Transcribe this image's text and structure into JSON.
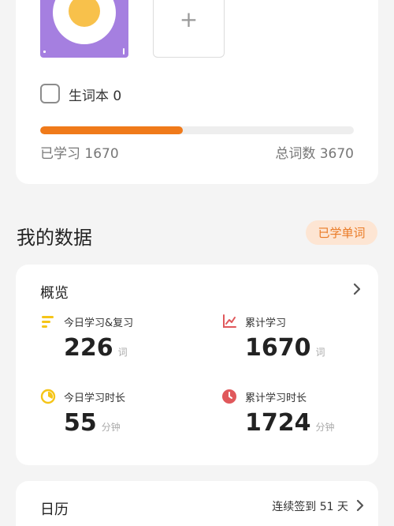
{
  "book": {
    "add_symbol": "+",
    "vocab_checkbox_label": "生词本 0"
  },
  "progress": {
    "learned_label": "已学习 1670",
    "total_label": "总词数 3670",
    "learned": 1670,
    "total": 3670
  },
  "my_data": {
    "title": "我的数据",
    "learned_words_button": "已学单词"
  },
  "overview": {
    "title": "概览",
    "stats": [
      {
        "label": "今日学习&复习",
        "value": "226",
        "unit": "词",
        "icon": "list-lines-icon"
      },
      {
        "label": "累计学习",
        "value": "1670",
        "unit": "词",
        "icon": "line-chart-icon"
      },
      {
        "label": "今日学习时长",
        "value": "55",
        "unit": "分钟",
        "icon": "pie-clock-icon"
      },
      {
        "label": "累计学习时长",
        "value": "1724",
        "unit": "分钟",
        "icon": "clock-icon"
      }
    ]
  },
  "calendar": {
    "title": "日历",
    "streak": "连续签到 51 天"
  },
  "colors": {
    "accent_orange": "#f07a1a",
    "icon_yellow": "#f5c518",
    "icon_red": "#e0585b",
    "book_purple": "#a57fe0"
  }
}
